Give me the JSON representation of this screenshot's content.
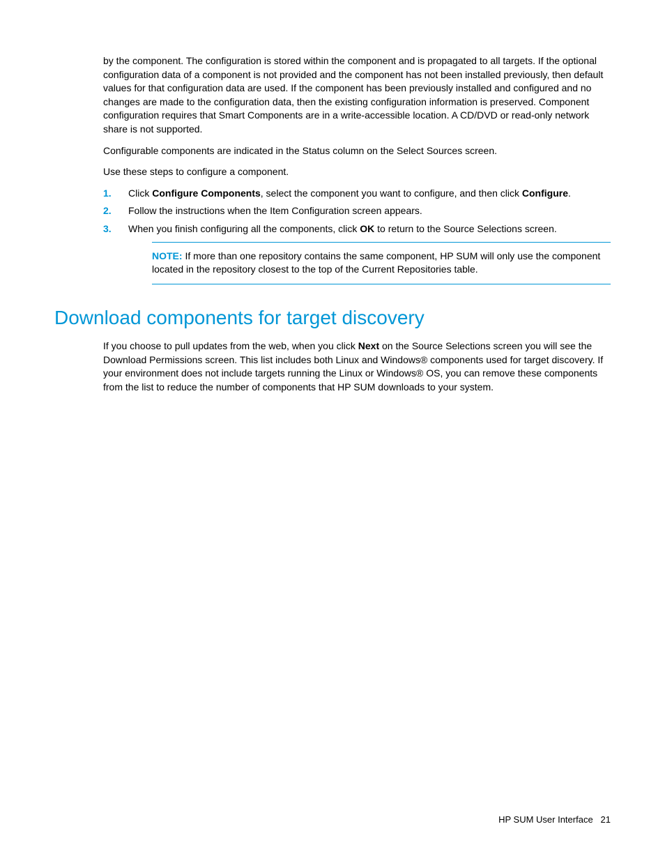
{
  "intro_para": "by the component. The configuration is stored within the component and is propagated to all targets. If the optional configuration data of a component is not provided and the component has not been installed previously, then default values for that configuration data are used. If the component has been previously installed and configured and no changes are made to the configuration data, then the existing configuration information is preserved. Component configuration requires that Smart Components are in a write-accessible location. A CD/DVD or read-only network share is not supported.",
  "para2": "Configurable components are indicated in the Status column on the Select Sources screen.",
  "para3": "Use these steps to configure a component.",
  "list": {
    "item1": {
      "num": "1.",
      "pre": "Click ",
      "bold1": "Configure Components",
      "mid": ", select the component you want to configure, and then click ",
      "bold2": "Configure",
      "post": "."
    },
    "item2": {
      "num": "2.",
      "text": "Follow the instructions when the Item Configuration screen appears."
    },
    "item3": {
      "num": "3.",
      "pre": "When you finish configuring all the components, click ",
      "bold1": "OK",
      "post": " to return to the Source Selections screen."
    }
  },
  "note": {
    "label": "NOTE:",
    "text": "If more than one repository contains the same component, HP SUM will only use the component located in the repository closest to the top of the Current Repositories table."
  },
  "heading": "Download components for target discovery",
  "section_para": {
    "pre": "If you choose to pull updates from the web, when you click ",
    "bold1": "Next",
    "post": " on the Source Selections screen you will see the Download Permissions screen. This list includes both Linux and Windows® components used for target discovery. If your environment does not include targets running the Linux or Windows® OS, you can remove these components from the list to reduce the number of components that HP SUM downloads to your system."
  },
  "footer": {
    "title": "HP SUM User Interface",
    "page": "21"
  }
}
